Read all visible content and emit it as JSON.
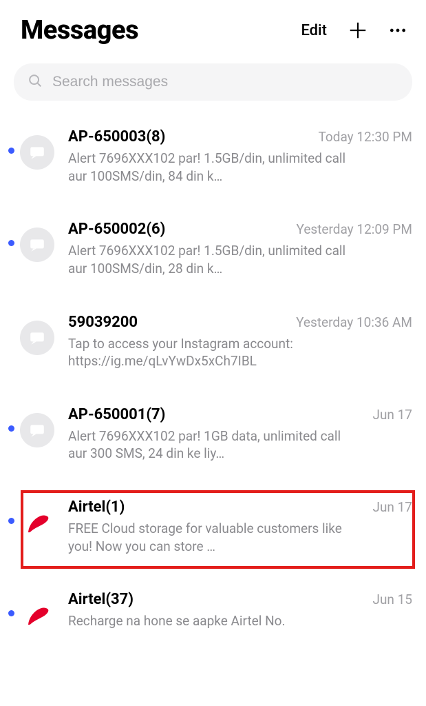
{
  "header": {
    "title": "Messages",
    "edit_label": "Edit"
  },
  "search": {
    "placeholder": "Search messages"
  },
  "conversations": [
    {
      "sender": "AP-650003(8)",
      "timestamp": "Today 12:30 PM",
      "preview": "Alert 7696XXX102 par! 1.5GB/din, unlimited call aur 100SMS/din, 84 din k…",
      "unread": true,
      "avatar": "default",
      "highlight": false
    },
    {
      "sender": "AP-650002(6)",
      "timestamp": "Yesterday 12:09 PM",
      "preview": "Alert 7696XXX102 par! 1.5GB/din, unlimited call aur 100SMS/din, 28 din k…",
      "unread": true,
      "avatar": "default",
      "highlight": false
    },
    {
      "sender": "59039200",
      "timestamp": "Yesterday 10:36 AM",
      "preview": "Tap to access your Instagram account: https://ig.me/qLvYwDx5xCh7IBL",
      "unread": false,
      "avatar": "default",
      "highlight": false
    },
    {
      "sender": "AP-650001(7)",
      "timestamp": "Jun 17",
      "preview": "Alert 7696XXX102 par!  1GB data, unlimited call aur 300 SMS, 24 din ke liy…",
      "unread": true,
      "avatar": "default",
      "highlight": false
    },
    {
      "sender": "Airtel(1)",
      "timestamp": "Jun 17",
      "preview": "FREE Cloud storage for valuable customers like you! Now you can store …",
      "unread": true,
      "avatar": "airtel",
      "highlight": true
    },
    {
      "sender": "Airtel(37)",
      "timestamp": "Jun 15",
      "preview": "Recharge na hone se aapke Airtel No.",
      "unread": true,
      "avatar": "airtel",
      "highlight": false
    }
  ]
}
